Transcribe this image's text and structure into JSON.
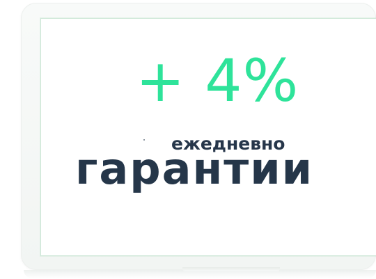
{
  "headline": {
    "value": "+ 4%",
    "accent_color": "#2ee39a"
  },
  "subtitle": {
    "small": "ежедневно",
    "large": "гарантии",
    "text_color": "#253649"
  }
}
